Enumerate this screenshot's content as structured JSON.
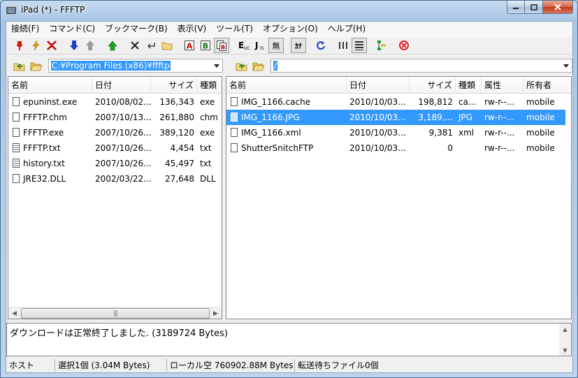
{
  "window": {
    "title": "iPad (*) - FFFTP"
  },
  "menu": [
    "接続(F)",
    "コマンド(C)",
    "ブックマーク(B)",
    "表示(V)",
    "ツール(T)",
    "オプション(O)",
    "ヘルプ(H)"
  ],
  "toolbar": {
    "items": [
      {
        "name": "connect-icon",
        "color": "#d81818"
      },
      {
        "name": "quick-connect-icon",
        "color": "#e0a000"
      },
      {
        "name": "disconnect-icon",
        "color": "#b01010"
      },
      {
        "name": "download-icon",
        "color": "#1a3fbf"
      },
      {
        "name": "upload-icon",
        "color": "#9a9a9a"
      },
      {
        "name": "mirror-upload-icon",
        "color": "#1fa01f"
      },
      {
        "name": "delete-icon",
        "color": "#202020"
      },
      {
        "name": "rename-icon",
        "color": "#404040"
      },
      {
        "name": "new-folder-icon",
        "color": "#d8b040"
      },
      {
        "name": "ascii-mode-icon",
        "label": "A",
        "color": "#c00000"
      },
      {
        "name": "binary-mode-icon",
        "label": "B",
        "color": "#107010"
      },
      {
        "name": "auto-mode-icon",
        "color": "#c00000"
      },
      {
        "name": "euc-kanji-icon",
        "label": "E",
        "sub": "UC"
      },
      {
        "name": "jis-kanji-icon",
        "label": "J",
        "sub": "IS"
      },
      {
        "name": "no-kanji-convert-icon",
        "label": "無"
      },
      {
        "name": "half-kana-icon",
        "label": "ｶﾅ"
      },
      {
        "name": "refresh-icon",
        "color": "#1a3fbf"
      },
      {
        "name": "list-view-icon"
      },
      {
        "name": "detail-view-icon"
      },
      {
        "name": "directory-sync-icon",
        "color": "#1fa01f"
      },
      {
        "name": "stop-icon",
        "color": "#e02020"
      }
    ]
  },
  "local": {
    "path": "C:¥Program Files (x86)¥ffftp",
    "columns": [
      "名前",
      "日付",
      "サイズ",
      "種類"
    ],
    "files": [
      {
        "name": "epuninst.exe",
        "date": "2010/08/02...",
        "size": "136,343",
        "type": "exe",
        "icon": "file"
      },
      {
        "name": "FFFTP.chm",
        "date": "2007/10/13...",
        "size": "261,880",
        "type": "chm",
        "icon": "file"
      },
      {
        "name": "FFFTP.exe",
        "date": "2007/10/26...",
        "size": "389,120",
        "type": "exe",
        "icon": "file"
      },
      {
        "name": "FFFTP.txt",
        "date": "2007/10/26...",
        "size": "4,454",
        "type": "txt",
        "icon": "txt"
      },
      {
        "name": "history.txt",
        "date": "2007/10/26...",
        "size": "45,497",
        "type": "txt",
        "icon": "txt"
      },
      {
        "name": "JRE32.DLL",
        "date": "2002/03/22...",
        "size": "27,648",
        "type": "DLL",
        "icon": "file"
      }
    ]
  },
  "remote": {
    "path": "/",
    "columns": [
      "名前",
      "日付",
      "サイズ",
      "種類",
      "属性",
      "所有者"
    ],
    "files": [
      {
        "name": "IMG_1166.cache",
        "date": "2010/10/03...",
        "size": "198,812",
        "type": "ca...",
        "attr": "rw-r--...",
        "owner": "mobile",
        "icon": "file",
        "selected": false
      },
      {
        "name": "IMG_1166.JPG",
        "date": "2010/10/03...",
        "size": "3,189,...",
        "type": "JPG",
        "attr": "rw-r--...",
        "owner": "mobile",
        "icon": "file",
        "selected": true
      },
      {
        "name": "IMG_1166.xml",
        "date": "2010/10/03...",
        "size": "9,381",
        "type": "xml",
        "attr": "rw-r--...",
        "owner": "mobile",
        "icon": "file",
        "selected": false
      },
      {
        "name": "ShutterSnitchFTP",
        "date": "2010/10/03...",
        "size": "0",
        "type": "",
        "attr": "rw-r--...",
        "owner": "mobile",
        "icon": "file",
        "selected": false
      }
    ]
  },
  "log": {
    "text": "ダウンロードは正常終了しました. (3189724 Bytes)"
  },
  "status": {
    "host": "ホスト",
    "selection": "選択1個 (3.04M Bytes)",
    "local_free": "ローカル空 760902.88M Bytes",
    "queue": "転送待ちファイル0個"
  },
  "colors": {
    "selection": "#3399ff",
    "chrome": "#f0f0f0"
  }
}
